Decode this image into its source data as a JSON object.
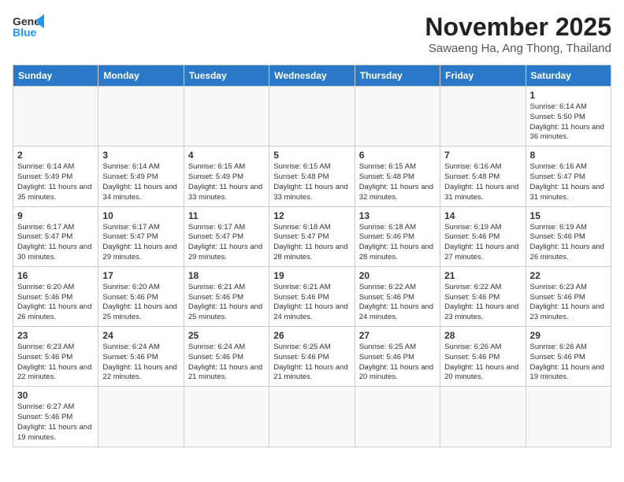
{
  "header": {
    "logo_line1": "General",
    "logo_line2": "Blue",
    "month_title": "November 2025",
    "subtitle": "Sawaeng Ha, Ang Thong, Thailand"
  },
  "weekdays": [
    "Sunday",
    "Monday",
    "Tuesday",
    "Wednesday",
    "Thursday",
    "Friday",
    "Saturday"
  ],
  "weeks": [
    [
      {
        "date": "",
        "info": ""
      },
      {
        "date": "",
        "info": ""
      },
      {
        "date": "",
        "info": ""
      },
      {
        "date": "",
        "info": ""
      },
      {
        "date": "",
        "info": ""
      },
      {
        "date": "",
        "info": ""
      },
      {
        "date": "1",
        "info": "Sunrise: 6:14 AM\nSunset: 5:50 PM\nDaylight: 11 hours and 36 minutes."
      }
    ],
    [
      {
        "date": "2",
        "info": "Sunrise: 6:14 AM\nSunset: 5:49 PM\nDaylight: 11 hours and 35 minutes."
      },
      {
        "date": "3",
        "info": "Sunrise: 6:14 AM\nSunset: 5:49 PM\nDaylight: 11 hours and 34 minutes."
      },
      {
        "date": "4",
        "info": "Sunrise: 6:15 AM\nSunset: 5:49 PM\nDaylight: 11 hours and 33 minutes."
      },
      {
        "date": "5",
        "info": "Sunrise: 6:15 AM\nSunset: 5:48 PM\nDaylight: 11 hours and 33 minutes."
      },
      {
        "date": "6",
        "info": "Sunrise: 6:15 AM\nSunset: 5:48 PM\nDaylight: 11 hours and 32 minutes."
      },
      {
        "date": "7",
        "info": "Sunrise: 6:16 AM\nSunset: 5:48 PM\nDaylight: 11 hours and 31 minutes."
      },
      {
        "date": "8",
        "info": "Sunrise: 6:16 AM\nSunset: 5:47 PM\nDaylight: 11 hours and 31 minutes."
      }
    ],
    [
      {
        "date": "9",
        "info": "Sunrise: 6:17 AM\nSunset: 5:47 PM\nDaylight: 11 hours and 30 minutes."
      },
      {
        "date": "10",
        "info": "Sunrise: 6:17 AM\nSunset: 5:47 PM\nDaylight: 11 hours and 29 minutes."
      },
      {
        "date": "11",
        "info": "Sunrise: 6:17 AM\nSunset: 5:47 PM\nDaylight: 11 hours and 29 minutes."
      },
      {
        "date": "12",
        "info": "Sunrise: 6:18 AM\nSunset: 5:47 PM\nDaylight: 11 hours and 28 minutes."
      },
      {
        "date": "13",
        "info": "Sunrise: 6:18 AM\nSunset: 5:46 PM\nDaylight: 11 hours and 28 minutes."
      },
      {
        "date": "14",
        "info": "Sunrise: 6:19 AM\nSunset: 5:46 PM\nDaylight: 11 hours and 27 minutes."
      },
      {
        "date": "15",
        "info": "Sunrise: 6:19 AM\nSunset: 5:46 PM\nDaylight: 11 hours and 26 minutes."
      }
    ],
    [
      {
        "date": "16",
        "info": "Sunrise: 6:20 AM\nSunset: 5:46 PM\nDaylight: 11 hours and 26 minutes."
      },
      {
        "date": "17",
        "info": "Sunrise: 6:20 AM\nSunset: 5:46 PM\nDaylight: 11 hours and 25 minutes."
      },
      {
        "date": "18",
        "info": "Sunrise: 6:21 AM\nSunset: 5:46 PM\nDaylight: 11 hours and 25 minutes."
      },
      {
        "date": "19",
        "info": "Sunrise: 6:21 AM\nSunset: 5:46 PM\nDaylight: 11 hours and 24 minutes."
      },
      {
        "date": "20",
        "info": "Sunrise: 6:22 AM\nSunset: 5:46 PM\nDaylight: 11 hours and 24 minutes."
      },
      {
        "date": "21",
        "info": "Sunrise: 6:22 AM\nSunset: 5:46 PM\nDaylight: 11 hours and 23 minutes."
      },
      {
        "date": "22",
        "info": "Sunrise: 6:23 AM\nSunset: 5:46 PM\nDaylight: 11 hours and 23 minutes."
      }
    ],
    [
      {
        "date": "23",
        "info": "Sunrise: 6:23 AM\nSunset: 5:46 PM\nDaylight: 11 hours and 22 minutes."
      },
      {
        "date": "24",
        "info": "Sunrise: 6:24 AM\nSunset: 5:46 PM\nDaylight: 11 hours and 22 minutes."
      },
      {
        "date": "25",
        "info": "Sunrise: 6:24 AM\nSunset: 5:46 PM\nDaylight: 11 hours and 21 minutes."
      },
      {
        "date": "26",
        "info": "Sunrise: 6:25 AM\nSunset: 5:46 PM\nDaylight: 11 hours and 21 minutes."
      },
      {
        "date": "27",
        "info": "Sunrise: 6:25 AM\nSunset: 5:46 PM\nDaylight: 11 hours and 20 minutes."
      },
      {
        "date": "28",
        "info": "Sunrise: 6:26 AM\nSunset: 5:46 PM\nDaylight: 11 hours and 20 minutes."
      },
      {
        "date": "29",
        "info": "Sunrise: 6:26 AM\nSunset: 5:46 PM\nDaylight: 11 hours and 19 minutes."
      }
    ],
    [
      {
        "date": "30",
        "info": "Sunrise: 6:27 AM\nSunset: 5:46 PM\nDaylight: 11 hours and 19 minutes."
      },
      {
        "date": "",
        "info": ""
      },
      {
        "date": "",
        "info": ""
      },
      {
        "date": "",
        "info": ""
      },
      {
        "date": "",
        "info": ""
      },
      {
        "date": "",
        "info": ""
      },
      {
        "date": "",
        "info": ""
      }
    ]
  ]
}
